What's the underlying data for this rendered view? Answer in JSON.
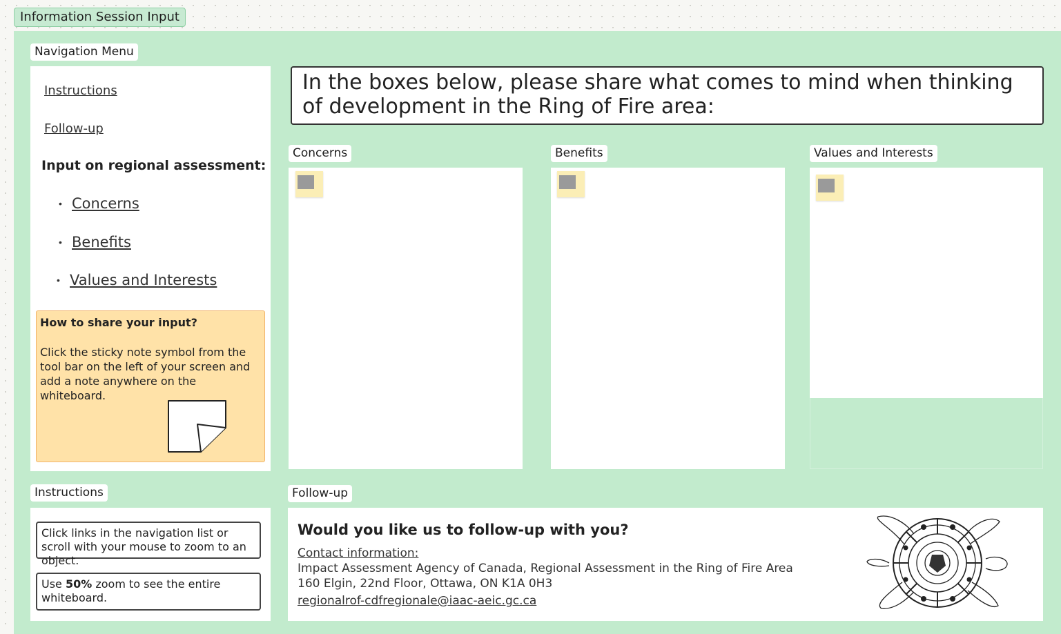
{
  "frame": {
    "title": "Information Session Input"
  },
  "nav": {
    "label": "Navigation Menu",
    "instructions_link": "Instructions",
    "followup_link": "Follow-up",
    "heading": "Input on regional assessment:",
    "items": [
      {
        "bullet": "•",
        "label": "Concerns"
      },
      {
        "bullet": "•",
        "label": "Benefits"
      },
      {
        "bullet": "•",
        "label": "Values and Interests"
      }
    ],
    "howto": {
      "title": "How to share your input?",
      "body": "Click the sticky note symbol from the tool bar on the left of your screen and add a note anywhere on the whiteboard."
    }
  },
  "prompt": {
    "text": "In the boxes below, please share what comes to mind when thinking of development in the Ring of Fire area:"
  },
  "columns": [
    {
      "label": "Concerns"
    },
    {
      "label": "Benefits"
    },
    {
      "label": "Values and Interests"
    }
  ],
  "instructions": {
    "label": "Instructions",
    "box1": "Click links in the navigation list or scroll with your mouse to zoom to an object.",
    "box2_prefix": "Use ",
    "box2_bold": "50%",
    "box2_suffix": " zoom to see the entire whiteboard."
  },
  "followup": {
    "label": "Follow-up",
    "question": "Would you like us to follow-up with you?",
    "contact_label": "Contact information:",
    "agency": "Impact Assessment Agency of Canada, Regional Assessment in the Ring of Fire Area",
    "address": "160 Elgin, 22nd Floor, Ottawa, ON K1A 0H3",
    "email": "regionalrof-cdfregionale@iaac-aeic.gc.ca"
  },
  "icons": {
    "sticky_note_symbol": "sticky-note-icon",
    "turtle_logo": "turtle-logo"
  },
  "colors": {
    "canvas_green": "#c2ebcd",
    "howto_orange": "#ffe2a8",
    "sticky_yellow": "#fbeeb6"
  }
}
